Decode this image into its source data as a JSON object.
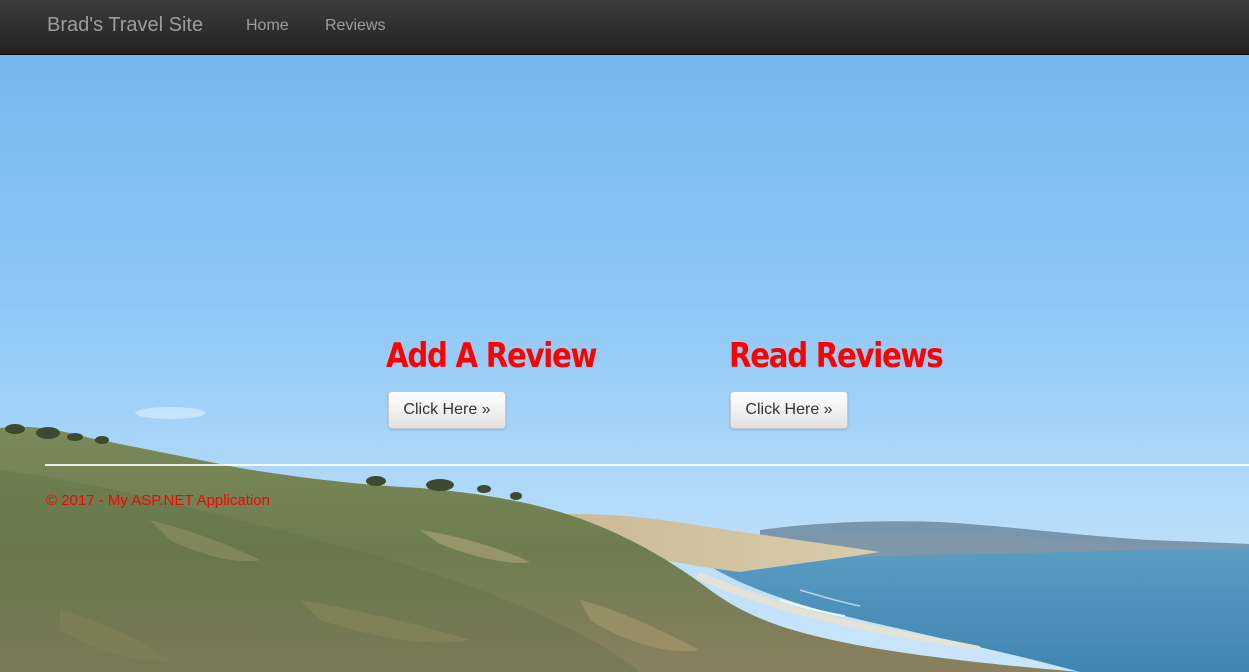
{
  "navbar": {
    "brand": "Brad's Travel Site",
    "links": [
      {
        "label": "Home"
      },
      {
        "label": "Reviews"
      }
    ]
  },
  "sections": {
    "add_review": {
      "heading": "Add A Review",
      "button_label": "Click Here »"
    },
    "read_reviews": {
      "heading": "Read Reviews",
      "button_label": "Click Here »"
    }
  },
  "footer": {
    "text": "© 2017 - My ASP.NET Application"
  },
  "colors": {
    "navbar_bg": "#222222",
    "nav_text": "#9d9d9d",
    "heading_red": "#ff0000",
    "footer_red": "#ff0000"
  },
  "background": {
    "description_icon": "coastal-landscape-photo"
  }
}
